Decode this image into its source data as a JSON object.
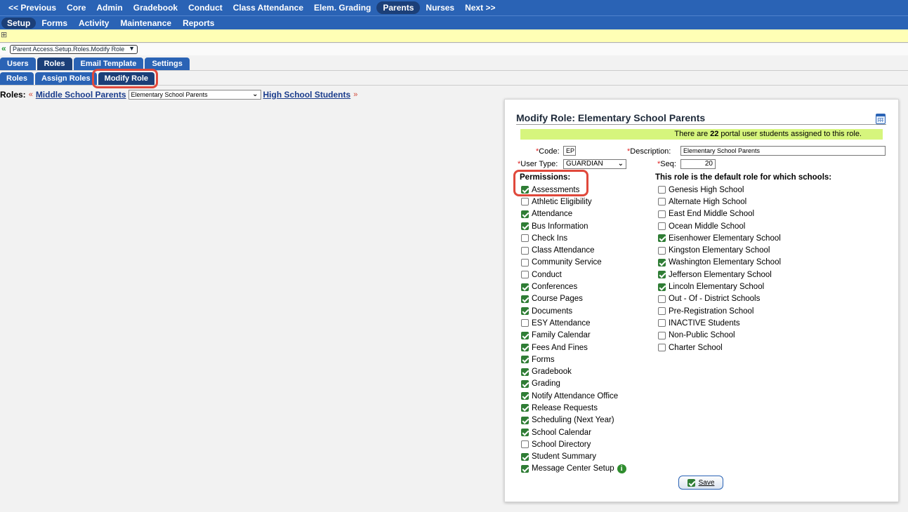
{
  "top_menu": [
    "<< Previous",
    "Core",
    "Admin",
    "Gradebook",
    "Conduct",
    "Class Attendance",
    "Elem. Grading",
    "Parents",
    "Nurses",
    "Next >>"
  ],
  "top_menu_active": "Parents",
  "sub_menu": [
    "Setup",
    "Forms",
    "Activity",
    "Maintenance",
    "Reports"
  ],
  "sub_menu_active": "Setup",
  "breadcrumb": "Parent Access.Setup.Roles.Modify Role",
  "tabs1": [
    "Users",
    "Roles",
    "Email Template",
    "Settings"
  ],
  "tabs2": [
    "Roles",
    "Assign Roles",
    "Modify Role"
  ],
  "roles_nav": {
    "label": "Roles:",
    "prev_link": "Middle School Parents",
    "selected": "Elementary School Parents",
    "next_link": "High School Students"
  },
  "panel": {
    "title": "Modify Role: Elementary School Parents",
    "notice_pre": "There are ",
    "notice_count": "22",
    "notice_post": " portal user students assigned to this role.",
    "code_label": "Code:",
    "code_value": "EP",
    "desc_label": "Description:",
    "desc_value": "Elementary School Parents",
    "usertype_label": "User Type:",
    "usertype_value": "GUARDIAN",
    "seq_label": "Seq:",
    "seq_value": "20",
    "permissions_header": "Permissions:",
    "schools_header": "This role is the default role for which schools:",
    "save_label": "Save"
  },
  "permissions": [
    {
      "label": "Assessments",
      "checked": true
    },
    {
      "label": "Athletic Eligibility",
      "checked": false
    },
    {
      "label": "Attendance",
      "checked": true
    },
    {
      "label": "Bus Information",
      "checked": true
    },
    {
      "label": "Check Ins",
      "checked": false
    },
    {
      "label": "Class Attendance",
      "checked": false
    },
    {
      "label": "Community Service",
      "checked": false
    },
    {
      "label": "Conduct",
      "checked": false
    },
    {
      "label": "Conferences",
      "checked": true
    },
    {
      "label": "Course Pages",
      "checked": true
    },
    {
      "label": "Documents",
      "checked": true
    },
    {
      "label": "ESY Attendance",
      "checked": false
    },
    {
      "label": "Family Calendar",
      "checked": true
    },
    {
      "label": "Fees And Fines",
      "checked": true
    },
    {
      "label": "Forms",
      "checked": true
    },
    {
      "label": "Gradebook",
      "checked": true
    },
    {
      "label": "Grading",
      "checked": true
    },
    {
      "label": "Notify Attendance Office",
      "checked": true
    },
    {
      "label": "Release Requests",
      "checked": true
    },
    {
      "label": "Scheduling (Next Year)",
      "checked": true
    },
    {
      "label": "School Calendar",
      "checked": true
    },
    {
      "label": "School Directory",
      "checked": false
    },
    {
      "label": "Student Summary",
      "checked": true
    },
    {
      "label": "Message Center Setup",
      "checked": true,
      "info": true
    }
  ],
  "schools": [
    {
      "label": "Genesis High School",
      "checked": false
    },
    {
      "label": "Alternate High School",
      "checked": false
    },
    {
      "label": "East End Middle School",
      "checked": false
    },
    {
      "label": "Ocean Middle School",
      "checked": false
    },
    {
      "label": "Eisenhower Elementary School",
      "checked": true
    },
    {
      "label": "Kingston Elementary School",
      "checked": false
    },
    {
      "label": "Washington Elementary School",
      "checked": true
    },
    {
      "label": "Jefferson Elementary School",
      "checked": true
    },
    {
      "label": "Lincoln Elementary School",
      "checked": true
    },
    {
      "label": "Out - Of - District Schools",
      "checked": false
    },
    {
      "label": "Pre-Registration School",
      "checked": false
    },
    {
      "label": "INACTIVE Students",
      "checked": false
    },
    {
      "label": "Non-Public School",
      "checked": false
    },
    {
      "label": "Charter School",
      "checked": false
    }
  ],
  "colors": {
    "menu_blue": "#2a63b5",
    "menu_active": "#1b3f78",
    "notice_green": "#d6f57d",
    "check_green": "#2f7d35",
    "highlight_red": "#e0483b"
  }
}
